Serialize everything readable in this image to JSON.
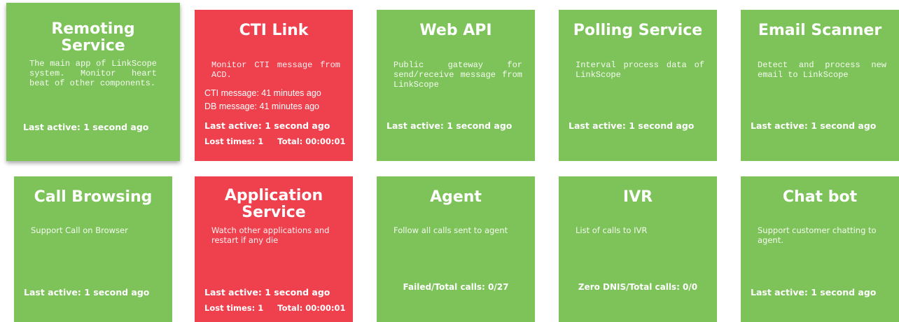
{
  "colors": {
    "ok": "#7dc35a",
    "error": "#ef404e",
    "text": "#ffffff"
  },
  "tiles": {
    "remoting": {
      "title_line1": "Remoting",
      "title_line2": "Service",
      "description": "The main app of LinkScope system. Monitor heart beat of other components.",
      "last_active": "Last active: 1 second ago",
      "status": "ok"
    },
    "cti": {
      "title": "CTI Link",
      "description": "Monitor CTI message from ACD.",
      "cti_message": "CTI message: 41 minutes ago",
      "db_message": "DB message:  41 minutes ago",
      "last_active": "Last active: 1 second ago",
      "lost_times": "Lost times: 1",
      "total": "Total: 00:00:01",
      "status": "error"
    },
    "webapi": {
      "title": "Web API",
      "description": "Public gateway for send/receive message from LinkScope",
      "last_active": "Last active: 1 second ago",
      "status": "ok"
    },
    "polling": {
      "title": "Polling Service",
      "description": "Interval process data of LinkScope",
      "last_active": "Last active: 1 second ago",
      "status": "ok"
    },
    "email": {
      "title": "Email Scanner",
      "description": "Detect and process new email to LinkScope",
      "last_active": "Last active: 1 second ago",
      "status": "ok"
    },
    "callbrowsing": {
      "title": "Call Browsing",
      "description": "Support Call on Browser",
      "last_active": "Last active: 1 second ago",
      "status": "ok"
    },
    "appservice": {
      "title_line1": "Application",
      "title_line2": "Service",
      "description": "Watch other applications and restart if any die",
      "last_active": "Last active: 1 second ago",
      "lost_times": "Lost times: 1",
      "total": "Total: 00:00:01",
      "status": "error"
    },
    "agent": {
      "title": "Agent",
      "description": "Follow all calls sent to agent",
      "stat": "Failed/Total calls: 0/27",
      "status": "ok"
    },
    "ivr": {
      "title": "IVR",
      "description": "List of calls to IVR",
      "stat": "Zero DNIS/Total calls: 0/0",
      "status": "ok"
    },
    "chatbot": {
      "title": "Chat bot",
      "description": "Support customer chatting to agent.",
      "last_active": "Last active: 1 second ago",
      "status": "ok"
    }
  }
}
